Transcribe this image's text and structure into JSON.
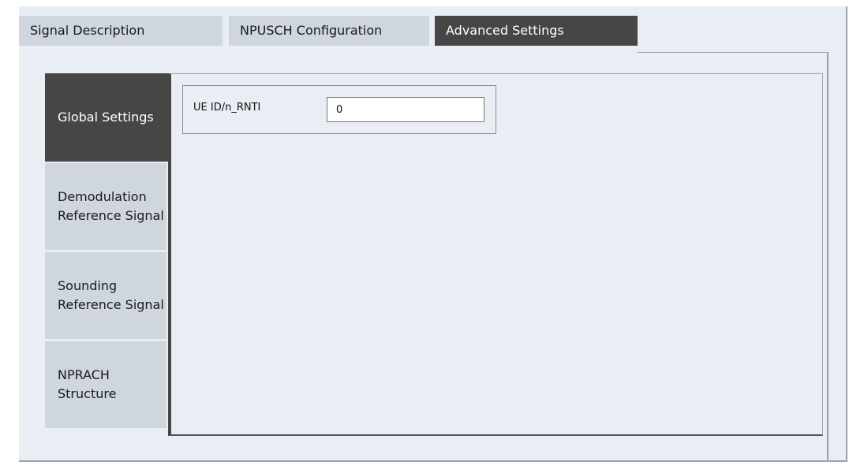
{
  "top_tabs": [
    {
      "label": "Signal Description",
      "active": false
    },
    {
      "label": "NPUSCH Configuration",
      "active": false
    },
    {
      "label": "Advanced Settings",
      "active": true
    }
  ],
  "side_tabs": [
    {
      "label": "Global Settings",
      "active": true
    },
    {
      "label": "Demodulation\nReference Signal",
      "active": false
    },
    {
      "label": "Sounding\nReference Signal",
      "active": false
    },
    {
      "label": "NPRACH\nStructure",
      "active": false
    }
  ],
  "global_settings": {
    "ue_id_label": "UE ID/n_RNTI",
    "ue_id_value": "0"
  },
  "colors": {
    "active_tab": "#464646",
    "inactive_tab": "#cfd6de",
    "panel_background": "#e9edf4"
  }
}
